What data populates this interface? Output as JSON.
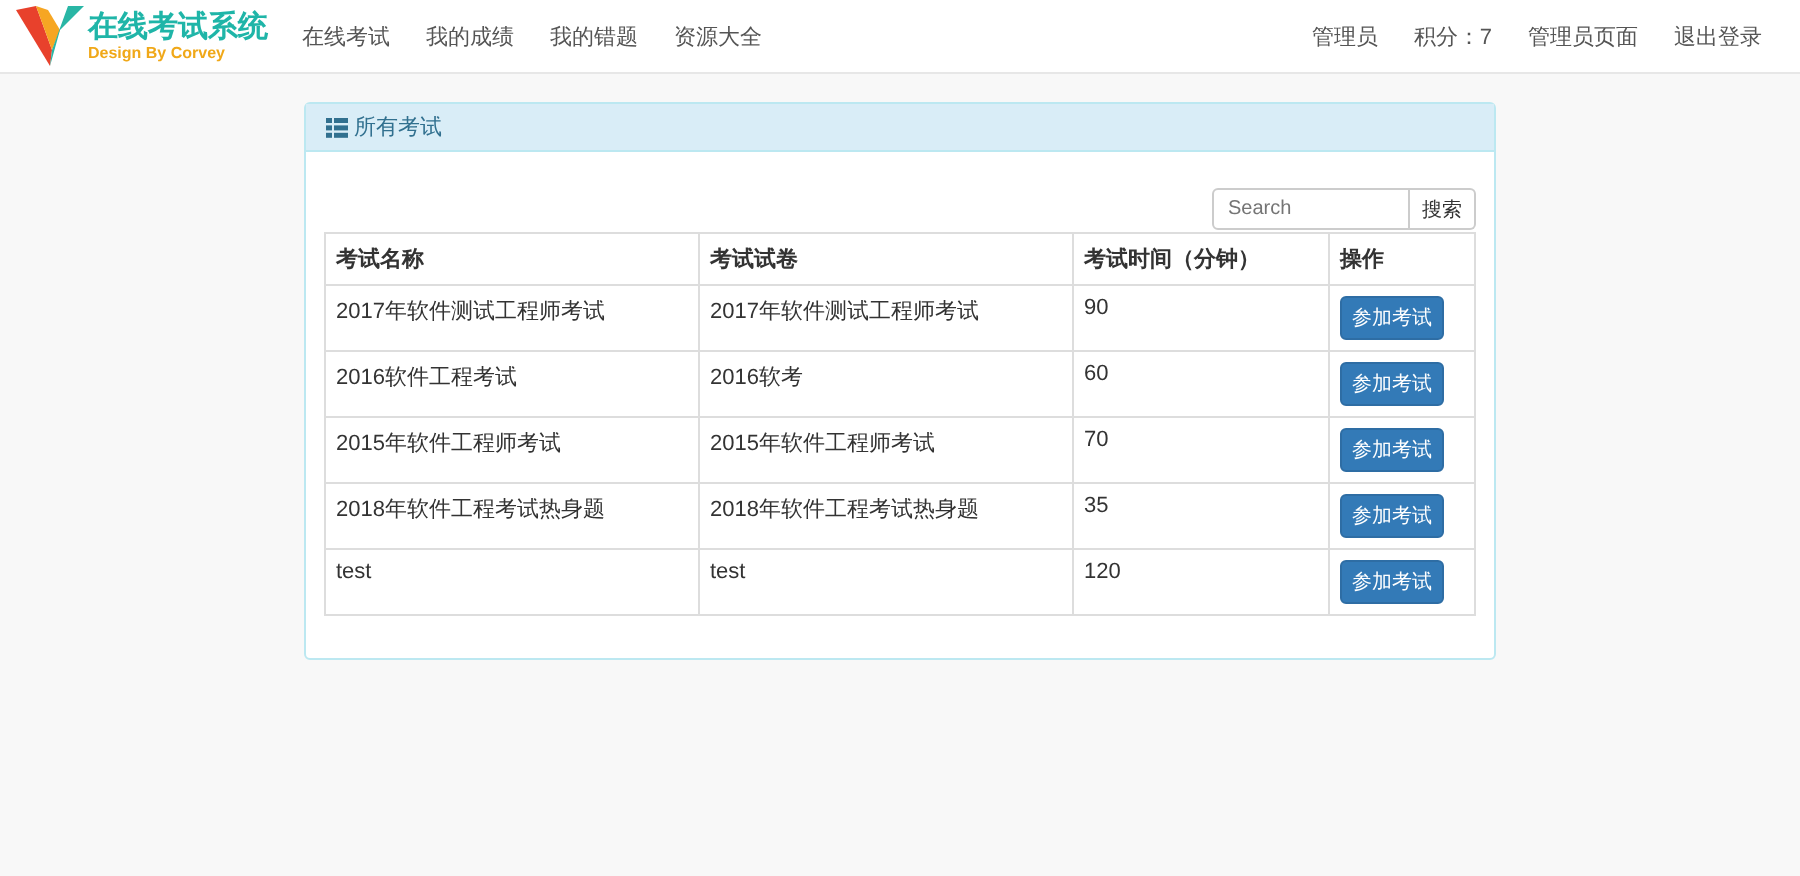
{
  "navbar": {
    "brand": {
      "title": "在线考试系统",
      "subtitle": "Design By Corvey"
    },
    "links": [
      {
        "label": "在线考试"
      },
      {
        "label": "我的成绩"
      },
      {
        "label": "我的错题"
      },
      {
        "label": "资源大全"
      }
    ],
    "right": [
      {
        "label": "管理员"
      },
      {
        "label": "积分：7"
      },
      {
        "label": "管理员页面"
      },
      {
        "label": "退出登录"
      }
    ]
  },
  "panel": {
    "title": "所有考试",
    "search": {
      "placeholder": "Search",
      "button": "搜索"
    },
    "table": {
      "columns": [
        "考试名称",
        "考试试卷",
        "考试时间（分钟）",
        "操作"
      ],
      "rows": [
        {
          "name": "2017年软件测试工程师考试",
          "paper": "2017年软件测试工程师考试",
          "time": "90",
          "action": "参加考试"
        },
        {
          "name": "2016软件工程考试",
          "paper": "2016软考",
          "time": "60",
          "action": "参加考试"
        },
        {
          "name": "2015年软件工程师考试",
          "paper": "2015年软件工程师考试",
          "time": "70",
          "action": "参加考试"
        },
        {
          "name": "2018年软件工程考试热身题",
          "paper": "2018年软件工程考试热身题",
          "time": "35",
          "action": "参加考试"
        },
        {
          "name": "test",
          "paper": "test",
          "time": "120",
          "action": "参加考试"
        }
      ]
    }
  }
}
